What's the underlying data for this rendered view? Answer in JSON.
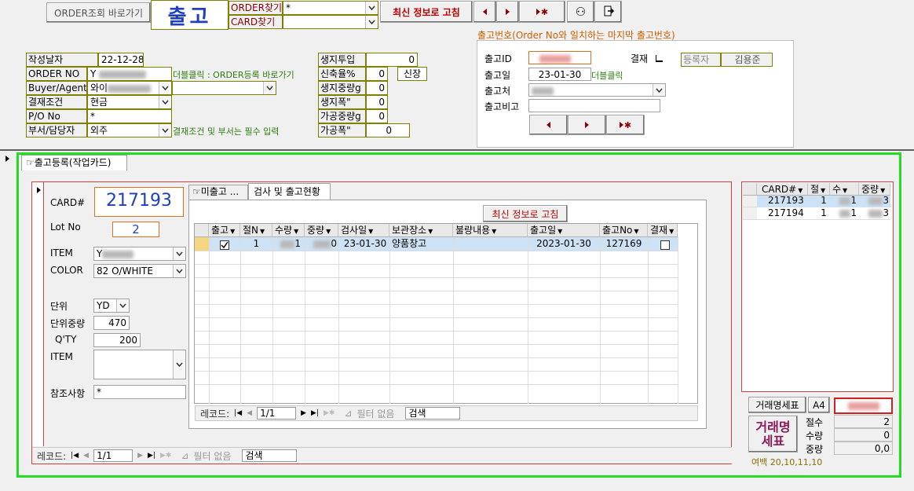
{
  "top": {
    "order_goto_label": "ORDER조회 바로가기",
    "title": "출고",
    "order_find_label": "ORDER찾기",
    "order_find_value": "*",
    "card_find_label": "CARD찾기",
    "card_find_value": "",
    "refresh_label": "최신 정보로 고침"
  },
  "info": {
    "date_label": "작성날자",
    "date_value": "22-12-28",
    "order_no_label": "ORDER NO",
    "order_no_value": "Y",
    "order_hint": "더블클릭 : ORDER등록 바로가기",
    "buyer_label": "Buyer/Agent",
    "buyer_value": "와이",
    "terms_label": "결재조건",
    "terms_value": "현금",
    "po_label": "P/O No",
    "po_value": "*",
    "dept_label": "부서/담당자",
    "dept_value": "외주",
    "required_note": "결재조건 및 부서는 필수 입력"
  },
  "production": {
    "input_label": "생지투입",
    "input_value": "0",
    "shrink_label": "신축율%",
    "shrink_value": "0",
    "shrink_btn": "신장",
    "gweight_label": "생지중량g",
    "gweight_value": "0",
    "gwidth_label": "생지폭\"",
    "gwidth_value": "0",
    "pweight_label": "가공중량g",
    "pweight_value": "0",
    "pwidth_label": "가공폭\"",
    "pwidth_value": "0"
  },
  "shipment": {
    "caption": "출고번호(Order No와 일치하는 마지막 출고번호)",
    "id_label": "출고ID",
    "id_value": "",
    "payment_label": "결재",
    "registrar_label": "등록자",
    "registrar_value": "김용준",
    "date_label": "출고일",
    "date_value": "23-01-30",
    "date_hint": "더블클릭",
    "dest_label": "출고처",
    "dest_value": "",
    "note_label": "출고비고",
    "note_value": ""
  },
  "main_tab": "출고등록(작업카드)",
  "card": {
    "card_label": "CARD#",
    "card_value": "217193",
    "lot_label": "Lot No",
    "lot_value": "2",
    "item_label": "ITEM",
    "item_value": "Y",
    "color_label": "COLOR",
    "color_value": "82 O/WHITE",
    "unit_label": "단위",
    "unit_value": "YD",
    "unit_weight_label": "단위중량",
    "unit_weight_value": "470",
    "qty_label": "Q'TY",
    "qty_value": "200",
    "item2_label": "ITEM",
    "item2_value": "",
    "memo_label": "참조사항",
    "memo_value": "*"
  },
  "subtabs": [
    "미출고 ...",
    "검사 및 출고현황"
  ],
  "inspect": {
    "refresh_label": "최신 정보로 고침",
    "columns": [
      "출고",
      "절N",
      "수량",
      "중량",
      "검사일",
      "보관장소",
      "불량내용",
      "출고일",
      "출고No",
      "결재"
    ],
    "rows": [
      {
        "shipped": true,
        "seq": "1",
        "qty": "1",
        "weight": "0",
        "inspect_date": "23-01-30",
        "location": "양품창고",
        "defect": "",
        "ship_date": "2023-01-30",
        "ship_no": "127169",
        "approved": false
      }
    ]
  },
  "recnav": {
    "record_label": "레코드:",
    "inner_pos": "1/1",
    "outer_pos": "1/1",
    "filter_label": "필터 없음",
    "search_label": "검색"
  },
  "cards_list": {
    "columns": [
      "CARD#",
      "절",
      "수",
      "중량"
    ],
    "rows": [
      {
        "card": "217193",
        "seq": "1",
        "qty": "1",
        "weight": "3"
      },
      {
        "card": "217194",
        "seq": "1",
        "qty": "1",
        "weight": "3"
      }
    ]
  },
  "invoice": {
    "statement_btn": "거래명세표",
    "a4_btn": "A4",
    "big_btn": "거래명 세표",
    "count_label": "절수",
    "count_value": "2",
    "qty_label": "수량",
    "qty_value": "0",
    "weight_label": "중량",
    "weight_value": "0,0",
    "margin_text": "여백 20,10,11,10"
  }
}
